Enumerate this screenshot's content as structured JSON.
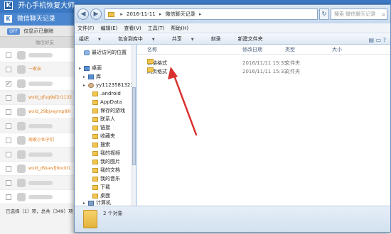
{
  "background_app": {
    "title": "开心手机恢复大师",
    "subtitle": "微信聊天记录",
    "logo_letter": "K",
    "toolbar_switch": "OFF",
    "toolbar_label": "仅显示已删除",
    "list_header": "微信好友",
    "rows": [
      {
        "name": "",
        "checked": false
      },
      {
        "name": "一家亲",
        "checked": false
      },
      {
        "name": "",
        "checked": true
      },
      {
        "name": "wxid_qfuq9sf2r1132",
        "checked": false
      },
      {
        "name": "wxid_29bjveymp8ih",
        "checked": false
      },
      {
        "name": "",
        "checked": false
      },
      {
        "name": "周家小伙子们",
        "checked": false
      },
      {
        "name": "",
        "checked": false
      },
      {
        "name": "wxid_d9uevfj9ockt1",
        "checked": false
      },
      {
        "name": "",
        "checked": false
      },
      {
        "name": "",
        "checked": false
      }
    ],
    "status": "已选择（1）项，总共（349）项"
  },
  "explorer": {
    "address": {
      "crumb1": "2016-11-11",
      "crumb2": "微信聊天记录",
      "sep": "▸",
      "back_glyph": "◀",
      "forward_glyph": "▶",
      "refresh_glyph": "↻"
    },
    "search_placeholder": "搜索 微信聊天记录",
    "menu": [
      "文件(F)",
      "编辑(E)",
      "查看(V)",
      "工具(T)",
      "帮助(H)"
    ],
    "commands": [
      {
        "label": "组织",
        "dropdown": true
      },
      {
        "label": "包含到库中",
        "dropdown": true
      },
      {
        "label": "共享",
        "dropdown": true
      },
      {
        "label": "刻录",
        "dropdown": false
      },
      {
        "label": "新建文件夹",
        "dropdown": false
      }
    ],
    "nav_tree": [
      {
        "label": "最近访问的位置",
        "icon": "recent-places-icon",
        "indent": 0
      },
      {
        "label": "桌面",
        "icon": "desktop-icon",
        "indent": 0
      },
      {
        "label": "库",
        "icon": "library-icon",
        "indent": 1
      },
      {
        "label": "yy1123581321",
        "icon": "user-folder-icon",
        "indent": 1
      },
      {
        "label": ".android",
        "icon": "folder-icon",
        "indent": 2
      },
      {
        "label": "AppData",
        "icon": "folder-icon",
        "indent": 2
      },
      {
        "label": "保存的游戏",
        "icon": "folder-icon",
        "indent": 2
      },
      {
        "label": "联系人",
        "icon": "folder-icon",
        "indent": 2
      },
      {
        "label": "链接",
        "icon": "folder-icon",
        "indent": 2
      },
      {
        "label": "收藏夹",
        "icon": "folder-icon",
        "indent": 2
      },
      {
        "label": "搜索",
        "icon": "folder-icon",
        "indent": 2
      },
      {
        "label": "我的视频",
        "icon": "folder-icon",
        "indent": 2
      },
      {
        "label": "我的图片",
        "icon": "folder-icon",
        "indent": 2
      },
      {
        "label": "我的文档",
        "icon": "folder-icon",
        "indent": 2
      },
      {
        "label": "我的音乐",
        "icon": "folder-icon",
        "indent": 2
      },
      {
        "label": "下载",
        "icon": "folder-icon",
        "indent": 2
      },
      {
        "label": "桌面",
        "icon": "folder-icon",
        "indent": 2
      },
      {
        "label": "计算机",
        "icon": "computer-icon",
        "indent": 1
      }
    ],
    "columns": {
      "name": "名称",
      "modified": "修改日期",
      "type": "类型",
      "size": "大小"
    },
    "files": [
      {
        "name": "表格格式",
        "modified": "2016/11/11 15:33",
        "type": "文件夹"
      },
      {
        "name": "网页格式",
        "modified": "2016/11/11 15:33",
        "type": "文件夹"
      }
    ],
    "status": "2 个对象"
  },
  "colors": {
    "pointer_arrow": "#d9312e",
    "titlebar": "#3b79c4"
  }
}
